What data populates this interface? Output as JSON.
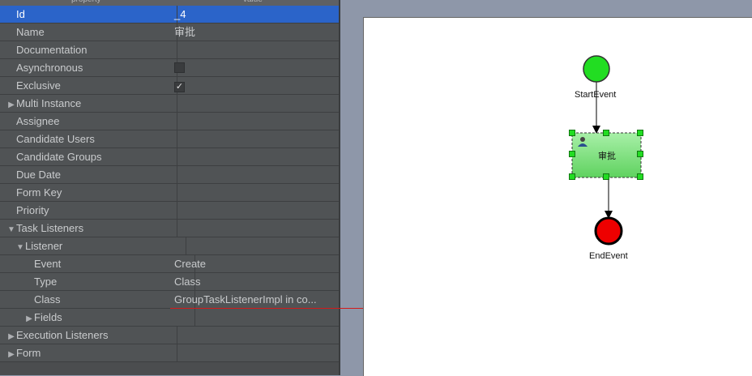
{
  "table": {
    "col_property": "property",
    "col_value": "value",
    "rows": [
      {
        "name": "Id",
        "value": "_4",
        "indent": 0,
        "arrow": "",
        "selected": true
      },
      {
        "name": "Name",
        "value": "审批",
        "indent": 0,
        "arrow": ""
      },
      {
        "name": "Documentation",
        "value": "",
        "indent": 0,
        "arrow": ""
      },
      {
        "name": "Asynchronous",
        "value": "",
        "indent": 0,
        "arrow": "",
        "checkbox": "unchecked"
      },
      {
        "name": "Exclusive",
        "value": "",
        "indent": 0,
        "arrow": "",
        "checkbox": "checked"
      },
      {
        "name": "Multi Instance",
        "value": "",
        "indent": 0,
        "arrow": "collapsed"
      },
      {
        "name": "Assignee",
        "value": "",
        "indent": 0,
        "arrow": ""
      },
      {
        "name": "Candidate Users",
        "value": "",
        "indent": 0,
        "arrow": ""
      },
      {
        "name": "Candidate Groups",
        "value": "",
        "indent": 0,
        "arrow": ""
      },
      {
        "name": "Due Date",
        "value": "",
        "indent": 0,
        "arrow": ""
      },
      {
        "name": "Form Key",
        "value": "",
        "indent": 0,
        "arrow": ""
      },
      {
        "name": "Priority",
        "value": "",
        "indent": 0,
        "arrow": ""
      },
      {
        "name": "Task Listeners",
        "value": "",
        "indent": 0,
        "arrow": "expanded"
      },
      {
        "name": "Listener",
        "value": "",
        "indent": 1,
        "arrow": "expanded"
      },
      {
        "name": "Event",
        "value": "Create",
        "indent": 2,
        "arrow": ""
      },
      {
        "name": "Type",
        "value": "Class",
        "indent": 2,
        "arrow": ""
      },
      {
        "name": "Class",
        "value": "GroupTaskListenerImpl in co...",
        "indent": 2,
        "arrow": ""
      },
      {
        "name": "Fields",
        "value": "",
        "indent": 2,
        "arrow": "collapsed"
      },
      {
        "name": "Execution Listeners",
        "value": "",
        "indent": 0,
        "arrow": "collapsed"
      },
      {
        "name": "Form",
        "value": "",
        "indent": 0,
        "arrow": "collapsed"
      }
    ]
  },
  "diagram": {
    "start_label": "StartEvent",
    "task_label": "审批",
    "end_label": "EndEvent",
    "task_icon": "user-icon",
    "colors": {
      "start": "#22dd22",
      "task": "#86e886",
      "end": "#ee0000",
      "selection": "#2b64c9"
    }
  }
}
